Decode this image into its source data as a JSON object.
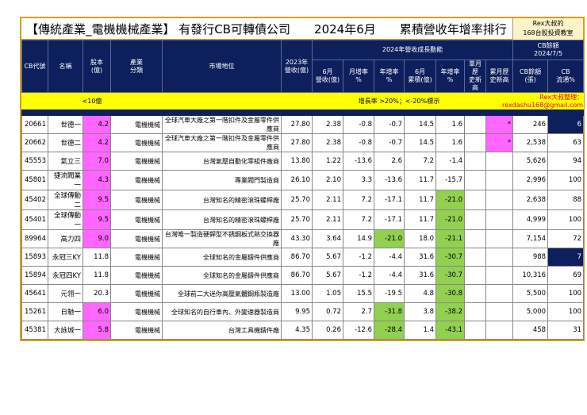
{
  "title": "【傳統產業_電機機械產業】 有發行CB可轉債公司　　2024年6月　　累積營收年增率排行",
  "brand": {
    "line1": "Rex大叔的",
    "line2": "168台股投資教室"
  },
  "headers": {
    "code": "CB代號",
    "name": "名稱",
    "capital": "股本\n(億)",
    "industry": "產業\n分類",
    "position": "市場地位",
    "rev2023": "2023年\n營收(億)",
    "group": "2024年營收成長動能",
    "cb_group": "CB餘額\n2024/7/5",
    "jun_rev": "6月\n營收(億)",
    "mom": "月增率\n%",
    "yoy": "年增率\n%",
    "jun_cum": "6月\n累積(億)",
    "cum_yoy": "年增率\n%",
    "month_high": "單月歷\n史新高",
    "cum_high": "累月歷\n史新高",
    "cb_bal": "CB餘額\n(張)",
    "cb_float": "CB\n流通%"
  },
  "legend": {
    "capital_note": "<10億",
    "rate_note": "增長率 >20%；<-20%標示",
    "credit": "Rex大叔整理：rexdashu168@gmail.com"
  },
  "rows": [
    {
      "code": "20661",
      "name": "世德一",
      "capital": "4.2",
      "industry": "電機機械",
      "position": "全球汽車大廠之第一階扣件及金屬零件供應商",
      "rev2023": "27.80",
      "jun_rev": "2.38",
      "mom": "-0.8",
      "yoy": "-0.7",
      "jun_cum": "14.5",
      "cum_yoy": "1.6",
      "month_high": "",
      "cum_high": "*",
      "cb_bal": "246",
      "cb_float": "6",
      "cap_hl": true,
      "yoy_hl": false,
      "cum_hl": false,
      "float_hl": true
    },
    {
      "code": "20662",
      "name": "世德二",
      "capital": "4.2",
      "industry": "電機機械",
      "position": "全球汽車大廠之第一階扣件及金屬零件供應商",
      "rev2023": "27.80",
      "jun_rev": "2.38",
      "mom": "-0.8",
      "yoy": "-0.7",
      "jun_cum": "14.5",
      "cum_yoy": "1.6",
      "month_high": "",
      "cum_high": "*",
      "cb_bal": "2,538",
      "cb_float": "63",
      "cap_hl": true,
      "yoy_hl": false,
      "cum_hl": false,
      "float_hl": false
    },
    {
      "code": "45553",
      "name": "氣立三",
      "capital": "7.0",
      "industry": "電機機械",
      "position": "台灣氣壓自動化零組件廠商",
      "rev2023": "13.80",
      "jun_rev": "1.22",
      "mom": "-13.6",
      "yoy": "2.6",
      "jun_cum": "7.2",
      "cum_yoy": "-1.4",
      "month_high": "",
      "cum_high": "",
      "cb_bal": "5,626",
      "cb_float": "94",
      "cap_hl": true,
      "yoy_hl": false,
      "cum_hl": false,
      "float_hl": false
    },
    {
      "code": "45801",
      "name": "捷流閥業一",
      "capital": "4.3",
      "industry": "電機機械",
      "position": "專業閥門製造商",
      "rev2023": "26.10",
      "jun_rev": "2.10",
      "mom": "3.3",
      "yoy": "-13.6",
      "jun_cum": "11.7",
      "cum_yoy": "-15.7",
      "month_high": "",
      "cum_high": "",
      "cb_bal": "2,996",
      "cb_float": "100",
      "cap_hl": true,
      "yoy_hl": false,
      "cum_hl": false,
      "float_hl": false
    },
    {
      "code": "45402",
      "name": "全球傳動二",
      "capital": "9.5",
      "industry": "電機機械",
      "position": "台灣知名的精密滾珠螺桿廠",
      "rev2023": "25.70",
      "jun_rev": "2.11",
      "mom": "7.2",
      "yoy": "-17.1",
      "jun_cum": "11.7",
      "cum_yoy": "-21.0",
      "month_high": "",
      "cum_high": "",
      "cb_bal": "2,638",
      "cb_float": "88",
      "cap_hl": true,
      "yoy_hl": false,
      "cum_hl": true,
      "float_hl": false
    },
    {
      "code": "45401",
      "name": "全球傳動一",
      "capital": "9.5",
      "industry": "電機機械",
      "position": "台灣知名的精密滾珠螺桿廠",
      "rev2023": "25.70",
      "jun_rev": "2.11",
      "mom": "7.2",
      "yoy": "-17.1",
      "jun_cum": "11.7",
      "cum_yoy": "-21.0",
      "month_high": "",
      "cum_high": "",
      "cb_bal": "4,999",
      "cb_float": "100",
      "cap_hl": true,
      "yoy_hl": false,
      "cum_hl": true,
      "float_hl": false
    },
    {
      "code": "89964",
      "name": "高力四",
      "capital": "9.0",
      "industry": "電機機械",
      "position": "台灣唯一製造硬銲型不銹鋼板式熱交換器廠",
      "rev2023": "43.30",
      "jun_rev": "3.64",
      "mom": "14.9",
      "yoy": "-21.0",
      "jun_cum": "18.0",
      "cum_yoy": "-21.1",
      "month_high": "",
      "cum_high": "",
      "cb_bal": "7,154",
      "cb_float": "72",
      "cap_hl": true,
      "yoy_hl": true,
      "cum_hl": true,
      "float_hl": false
    },
    {
      "code": "15893",
      "name": "永冠三KY",
      "capital": "11.8",
      "industry": "電機機械",
      "position": "全球知名的金屬鑄件供應商",
      "rev2023": "86.70",
      "jun_rev": "5.67",
      "mom": "-1.2",
      "yoy": "-4.4",
      "jun_cum": "31.6",
      "cum_yoy": "-30.7",
      "month_high": "",
      "cum_high": "",
      "cb_bal": "988",
      "cb_float": "7",
      "cap_hl": false,
      "yoy_hl": false,
      "cum_hl": true,
      "float_hl": true
    },
    {
      "code": "15894",
      "name": "永冠四KY",
      "capital": "11.8",
      "industry": "電機機械",
      "position": "全球知名的金屬鑄件供應商",
      "rev2023": "86.70",
      "jun_rev": "5.67",
      "mom": "-1.2",
      "yoy": "-4.4",
      "jun_cum": "31.6",
      "cum_yoy": "-30.7",
      "month_high": "",
      "cum_high": "",
      "cb_bal": "10,316",
      "cb_float": "69",
      "cap_hl": false,
      "yoy_hl": false,
      "cum_hl": true,
      "float_hl": false
    },
    {
      "code": "45641",
      "name": "元翎一",
      "capital": "20.3",
      "industry": "電機機械",
      "position": "全球前二大迷你高壓氣體鋼瓶製造廠",
      "rev2023": "13.00",
      "jun_rev": "1.05",
      "mom": "15.5",
      "yoy": "-19.5",
      "jun_cum": "4.8",
      "cum_yoy": "-30.8",
      "month_high": "",
      "cum_high": "",
      "cb_bal": "5,500",
      "cb_float": "100",
      "cap_hl": false,
      "yoy_hl": false,
      "cum_hl": true,
      "float_hl": false
    },
    {
      "code": "15261",
      "name": "日馳一",
      "capital": "6.0",
      "industry": "電機機械",
      "position": "全球知名的自行車內、外變速器製造商",
      "rev2023": "9.95",
      "jun_rev": "0.72",
      "mom": "2.7",
      "yoy": "-31.8",
      "jun_cum": "3.8",
      "cum_yoy": "-38.2",
      "month_high": "",
      "cum_high": "",
      "cb_bal": "5,000",
      "cb_float": "100",
      "cap_hl": true,
      "yoy_hl": true,
      "cum_hl": true,
      "float_hl": false
    },
    {
      "code": "45381",
      "name": "大詠城一",
      "capital": "5.8",
      "industry": "電機機械",
      "position": "台灣工具機鑄件廠",
      "rev2023": "4.35",
      "jun_rev": "0.26",
      "mom": "-12.6",
      "yoy": "-28.4",
      "jun_cum": "1.4",
      "cum_yoy": "-43.1",
      "month_high": "",
      "cum_high": "",
      "cb_bal": "458",
      "cb_float": "31",
      "cap_hl": true,
      "yoy_hl": true,
      "cum_hl": true,
      "float_hl": false
    }
  ]
}
